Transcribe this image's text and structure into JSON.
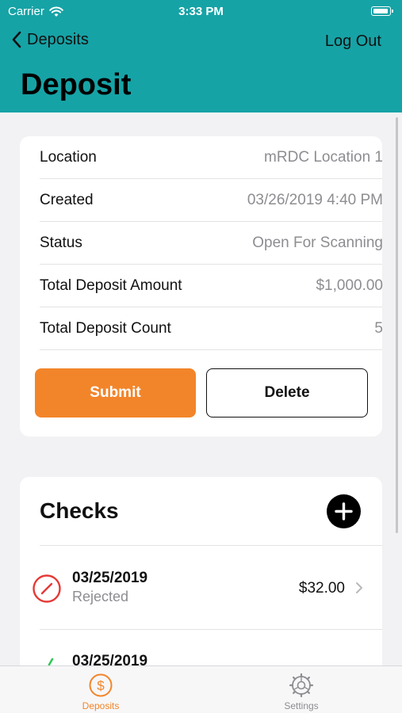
{
  "status_bar": {
    "carrier": "Carrier",
    "time": "3:33 PM"
  },
  "nav": {
    "back_label": "Deposits",
    "logout_label": "Log Out"
  },
  "page": {
    "title": "Deposit"
  },
  "deposit_info": {
    "rows": [
      {
        "label": "Location",
        "value": "mRDC Location 1"
      },
      {
        "label": "Created",
        "value": "03/26/2019 4:40 PM"
      },
      {
        "label": "Status",
        "value": "Open For Scanning"
      },
      {
        "label": "Total Deposit Amount",
        "value": "$1,000.00"
      },
      {
        "label": "Total Deposit Count",
        "value": "5"
      }
    ],
    "submit_label": "Submit",
    "delete_label": "Delete"
  },
  "checks": {
    "title": "Checks",
    "items": [
      {
        "date": "03/25/2019",
        "status": "Rejected",
        "amount": "$32.00",
        "status_icon": "rejected-icon"
      },
      {
        "date": "03/25/2019",
        "status": "",
        "amount": "",
        "status_icon": "accepted-check-icon"
      }
    ]
  },
  "tabbar": {
    "tabs": [
      {
        "label": "Deposits",
        "icon": "dollar-circle-icon",
        "active": true
      },
      {
        "label": "Settings",
        "icon": "gear-icon",
        "active": false
      }
    ]
  },
  "colors": {
    "header": "#16a3a6",
    "accent": "#f2852a",
    "rejected": "#e53935",
    "accepted": "#34c759"
  }
}
